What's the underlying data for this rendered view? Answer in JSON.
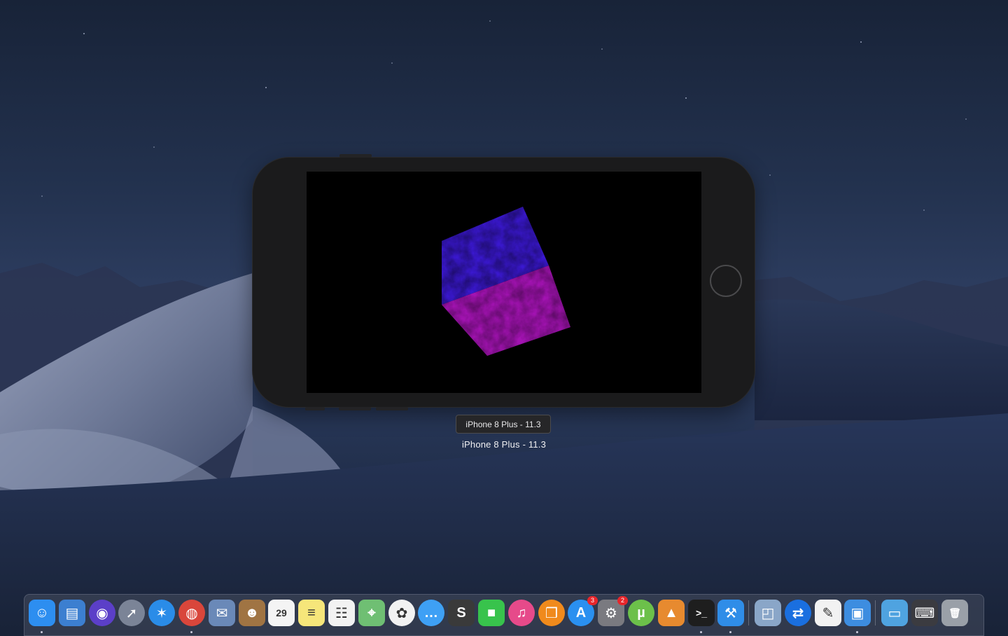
{
  "simulator": {
    "tooltip": "iPhone 8 Plus - 11.3",
    "device_label": "iPhone 8 Plus - 11.3",
    "cube_colors": {
      "top": "#3a18cf",
      "front": "#a413b3"
    }
  },
  "dock": {
    "items": [
      {
        "name": "finder",
        "icon": "finder-icon",
        "color": "#2d8ef0",
        "glyph": "☺",
        "running": true
      },
      {
        "name": "files",
        "icon": "folder-stack-icon",
        "color": "#3c7fd0",
        "glyph": "▤",
        "running": false
      },
      {
        "name": "siri",
        "icon": "siri-icon",
        "color": "#5b3fc8",
        "glyph": "◉",
        "round": true,
        "running": false
      },
      {
        "name": "launchpad",
        "icon": "rocket-icon",
        "color": "#7b8497",
        "glyph": "➚",
        "round": true,
        "running": false
      },
      {
        "name": "safari",
        "icon": "compass-icon",
        "color": "#2a8ce8",
        "glyph": "✶",
        "round": true,
        "running": false
      },
      {
        "name": "chrome",
        "icon": "chrome-icon",
        "color": "#d9463b",
        "glyph": "◍",
        "round": true,
        "running": true
      },
      {
        "name": "mail-stamp",
        "icon": "stamp-icon",
        "color": "#6a89b8",
        "glyph": "✉",
        "running": false
      },
      {
        "name": "contacts",
        "icon": "contacts-book-icon",
        "color": "#a07443",
        "glyph": "☻",
        "running": false
      },
      {
        "name": "calendar",
        "icon": "calendar-icon",
        "color": "#f4f4f4",
        "glyph": "29",
        "dark": true,
        "running": false
      },
      {
        "name": "notes",
        "icon": "notes-icon",
        "color": "#f6e67a",
        "glyph": "≡",
        "dark": true,
        "running": false
      },
      {
        "name": "reminders",
        "icon": "checklist-icon",
        "color": "#f2f2f2",
        "glyph": "☷",
        "dark": true,
        "running": false
      },
      {
        "name": "maps",
        "icon": "map-icon",
        "color": "#6fbf73",
        "glyph": "⌖",
        "running": false
      },
      {
        "name": "photos",
        "icon": "photos-flower-icon",
        "color": "#f2f2f2",
        "glyph": "✿",
        "dark": true,
        "round": true,
        "running": false
      },
      {
        "name": "messages",
        "icon": "speech-bubble-icon",
        "color": "#3ea0f5",
        "glyph": "…",
        "round": true,
        "running": false
      },
      {
        "name": "sublime",
        "icon": "sublime-s-icon",
        "color": "#3a3a3a",
        "glyph": "S",
        "running": false
      },
      {
        "name": "facetime",
        "icon": "video-camera-icon",
        "color": "#38c34c",
        "glyph": "■",
        "running": false
      },
      {
        "name": "itunes",
        "icon": "music-note-icon",
        "color": "#e64a8a",
        "glyph": "♫",
        "round": true,
        "running": false
      },
      {
        "name": "books",
        "icon": "open-book-icon",
        "color": "#f08a1c",
        "glyph": "❒",
        "round": true,
        "running": false
      },
      {
        "name": "app-store",
        "icon": "app-store-icon",
        "color": "#2a90f0",
        "glyph": "A",
        "round": true,
        "badge": "3",
        "running": false
      },
      {
        "name": "system-preferences",
        "icon": "gear-icon",
        "color": "#7a7a80",
        "glyph": "⚙",
        "badge": "2",
        "running": false
      },
      {
        "name": "utorrent",
        "icon": "utorrent-icon",
        "color": "#6cc04a",
        "glyph": "µ",
        "round": true,
        "running": false
      },
      {
        "name": "vlc-cone",
        "icon": "triangle-icon",
        "color": "#e78a2f",
        "glyph": "▲",
        "running": false
      },
      {
        "name": "terminal",
        "icon": "terminal-icon",
        "color": "#1e1e1e",
        "glyph": ">_",
        "running": true
      },
      {
        "name": "xcode",
        "icon": "hammer-icon",
        "color": "#2f8de8",
        "glyph": "⚒",
        "running": true
      }
    ],
    "right_items": [
      {
        "name": "preview",
        "icon": "photo-magnifier-icon",
        "color": "#8aa6c8",
        "glyph": "◰",
        "running": false
      },
      {
        "name": "teamviewer",
        "icon": "teamviewer-icon",
        "color": "#1a6fe0",
        "glyph": "⇄",
        "round": true,
        "running": false
      },
      {
        "name": "textedit",
        "icon": "pen-paper-icon",
        "color": "#f2f2f2",
        "glyph": "✎",
        "dark": true,
        "running": false
      },
      {
        "name": "simulator",
        "icon": "simulator-icon",
        "color": "#3d8de0",
        "glyph": "▣",
        "running": true
      }
    ],
    "stack_items": [
      {
        "name": "downloads-folder",
        "icon": "folder-icon",
        "color": "#4fa3e0",
        "glyph": "▭",
        "running": false
      },
      {
        "name": "keyboard-viewer",
        "icon": "keyboard-icon",
        "color": "#3b3b40",
        "glyph": "⌨",
        "running": false
      },
      {
        "name": "trash",
        "icon": "trash-icon",
        "color": "#9aa0a8",
        "glyph": "🗑",
        "running": false
      }
    ]
  }
}
